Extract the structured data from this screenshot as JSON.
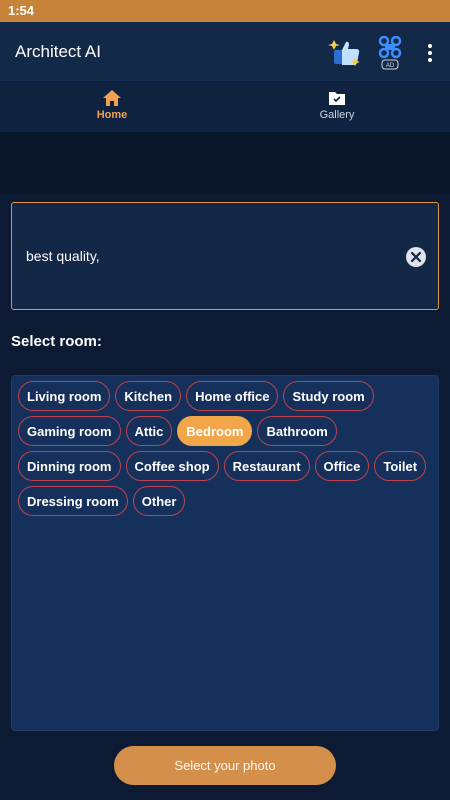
{
  "status_bar": {
    "time": "1:54"
  },
  "app_bar": {
    "title": "Architect AI",
    "icons": [
      "thumbs-up-sparkle-icon",
      "ad-command-icon",
      "more-vertical-icon"
    ]
  },
  "tabs": [
    {
      "label": "Home",
      "icon": "home-icon",
      "active": true
    },
    {
      "label": "Gallery",
      "icon": "gallery-folder-icon",
      "active": false
    }
  ],
  "prompt": {
    "value": "best quality,"
  },
  "rooms": {
    "label": "Select room:",
    "items": [
      "Living room",
      "Kitchen",
      "Home office",
      "Study room",
      "Gaming room",
      "Attic",
      "Bedroom",
      "Bathroom",
      "Dinning room",
      "Coffee shop",
      "Restaurant",
      "Office",
      "Toilet",
      "Dressing room",
      "Other"
    ],
    "selected": "Bedroom"
  },
  "cta": {
    "label": "Select your photo"
  },
  "colors": {
    "accent": "#f2a64a",
    "chip_border": "#c0424f",
    "background": "#0d1a33"
  }
}
